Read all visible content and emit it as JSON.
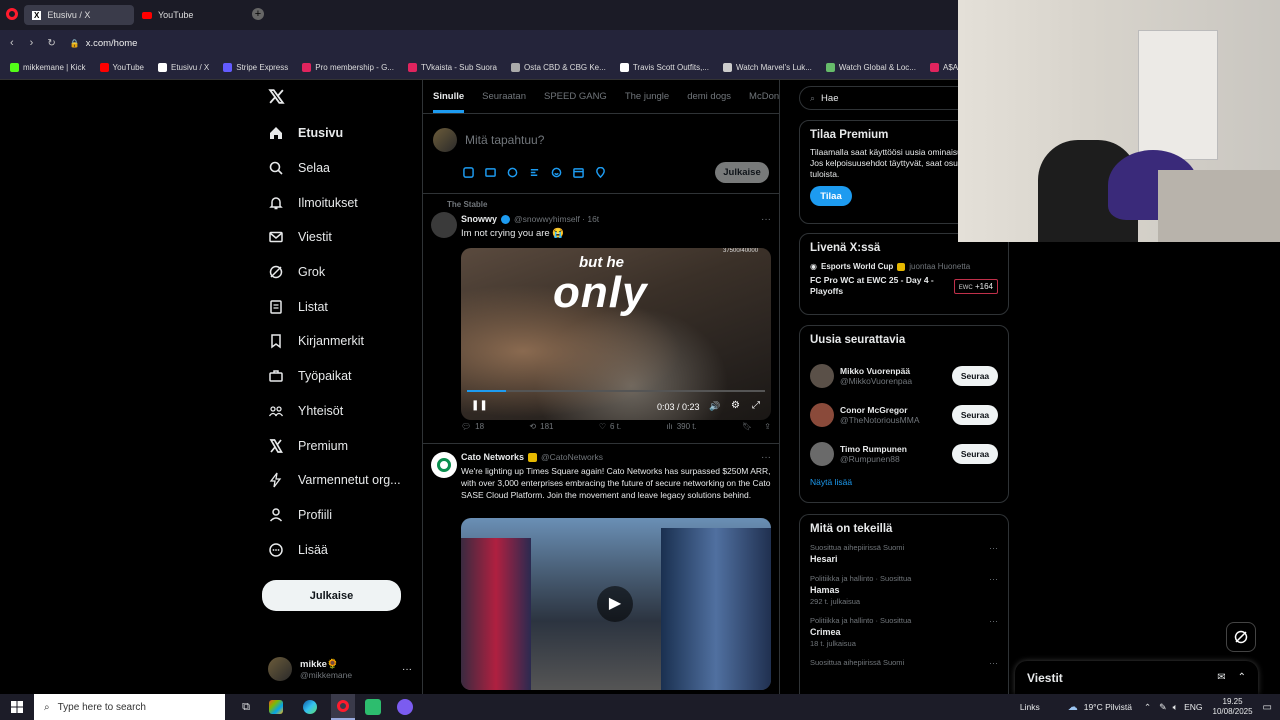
{
  "browser": {
    "tabs": [
      {
        "label": "Etusivu / X",
        "active": true
      },
      {
        "label": "YouTube",
        "active": false
      }
    ],
    "url": "x.com/home",
    "bookmarks": [
      {
        "label": "mikkemane | Kick",
        "color": "#53fc18"
      },
      {
        "label": "YouTube",
        "color": "#ff0000"
      },
      {
        "label": "Etusivu / X",
        "color": "#ffffff"
      },
      {
        "label": "Stripe Express",
        "color": "#635bff"
      },
      {
        "label": "Pro membership - G...",
        "color": "#e0245e"
      },
      {
        "label": "TVkaista - Sub Suora",
        "color": "#e0245e"
      },
      {
        "label": "Osta CBD & CBG Ke...",
        "color": "#aaaaaa"
      },
      {
        "label": "Travis Scott Outfits,...",
        "color": "#ffffff"
      },
      {
        "label": "Watch Marvel's Luk...",
        "color": "#cccccc"
      },
      {
        "label": "Watch Global & Loc...",
        "color": "#66bb6a"
      },
      {
        "label": "A$AP ROCKY » PU...",
        "color": "#e0245e"
      }
    ]
  },
  "nav": {
    "items": [
      {
        "label": "Etusivu",
        "icon": "home-icon"
      },
      {
        "label": "Selaa",
        "icon": "search-icon"
      },
      {
        "label": "Ilmoitukset",
        "icon": "bell-icon"
      },
      {
        "label": "Viestit",
        "icon": "mail-icon"
      },
      {
        "label": "Grok",
        "icon": "grok-icon"
      },
      {
        "label": "Listat",
        "icon": "list-icon"
      },
      {
        "label": "Kirjanmerkit",
        "icon": "bookmark-icon"
      },
      {
        "label": "Työpaikat",
        "icon": "briefcase-icon"
      },
      {
        "label": "Yhteisöt",
        "icon": "communities-icon"
      },
      {
        "label": "Premium",
        "icon": "x-icon"
      },
      {
        "label": "Varmennetut org...",
        "icon": "lightning-icon"
      },
      {
        "label": "Profiili",
        "icon": "person-icon"
      },
      {
        "label": "Lisää",
        "icon": "more-icon"
      }
    ],
    "post_button": "Julkaise",
    "user": {
      "name": "mikke🌻",
      "handle": "@mikkemane"
    }
  },
  "feed": {
    "tabs": [
      "Sinulle",
      "Seuraatan",
      "SPEED GANG",
      "The jungle",
      "demi dogs",
      "McDonal"
    ],
    "composer_placeholder": "Mitä tapahtuu?",
    "post_button": "Julkaise",
    "post1": {
      "context": "The Stable",
      "name": "Snowwy",
      "handle": "@snowwyhimself · 16t",
      "text": "Im not crying you are 😭",
      "video_caption_1": "but he",
      "video_caption_2": "only",
      "video_time": "0:03 / 0:23",
      "video_counter": "37500/40000",
      "replies": "18",
      "reposts": "181",
      "likes": "6 t.",
      "views": "390 t."
    },
    "post2": {
      "name": "Cato Networks",
      "handle": "@CatoNetworks",
      "text": "We're lighting up Times Square again! Cato Networks has surpassed $250M ARR, with over 3,000 enterprises embracing the future of secure networking on the Cato SASE Cloud Platform. Join the movement and leave legacy solutions behind."
    }
  },
  "sidebar": {
    "search": "Hae",
    "premium": {
      "title": "Tilaa Premium",
      "text": "Tilaamalla saat käyttöösi uusia ominaisuuksia. Jos kelpoisuusehdot täyttyvät, saat osuuden tuloista.",
      "button": "Tilaa"
    },
    "live": {
      "title": "Livenä X:ssä",
      "host": "Esports World Cup",
      "host_suffix": "juontaa Huonetta",
      "event": "FC Pro WC at EWC 25 - Day 4 - Playoffs",
      "count": "+164"
    },
    "follow": {
      "title": "Uusia seurattavia",
      "users": [
        {
          "name": "Mikko Vuorenpää",
          "handle": "@MikkoVuorenpaa"
        },
        {
          "name": "Conor McGregor",
          "handle": "@TheNotoriousMMA"
        },
        {
          "name": "Timo Rumpunen",
          "handle": "@Rumpunen88"
        }
      ],
      "button": "Seuraa",
      "more": "Näytä lisää"
    },
    "trends": {
      "title": "Mitä on tekeillä",
      "items": [
        {
          "meta": "Suosittua aihepiirissä Suomi",
          "name": "Hesari"
        },
        {
          "meta": "Politiikka ja hallinto · Suosittua",
          "name": "Hamas",
          "count": "292 t. julkaisua"
        },
        {
          "meta": "Politiikka ja hallinto · Suosittua",
          "name": "Crimea",
          "count": "18 t. julkaisua"
        },
        {
          "meta": "Suosittua aihepiirissä Suomi",
          "name": ""
        }
      ]
    }
  },
  "messages": {
    "title": "Viestit"
  },
  "taskbar": {
    "search": "Type here to search",
    "links": "Links",
    "weather": "19°C  Pilvistä",
    "lang": "ENG",
    "time": "19.25",
    "date": "10/08/2025"
  }
}
